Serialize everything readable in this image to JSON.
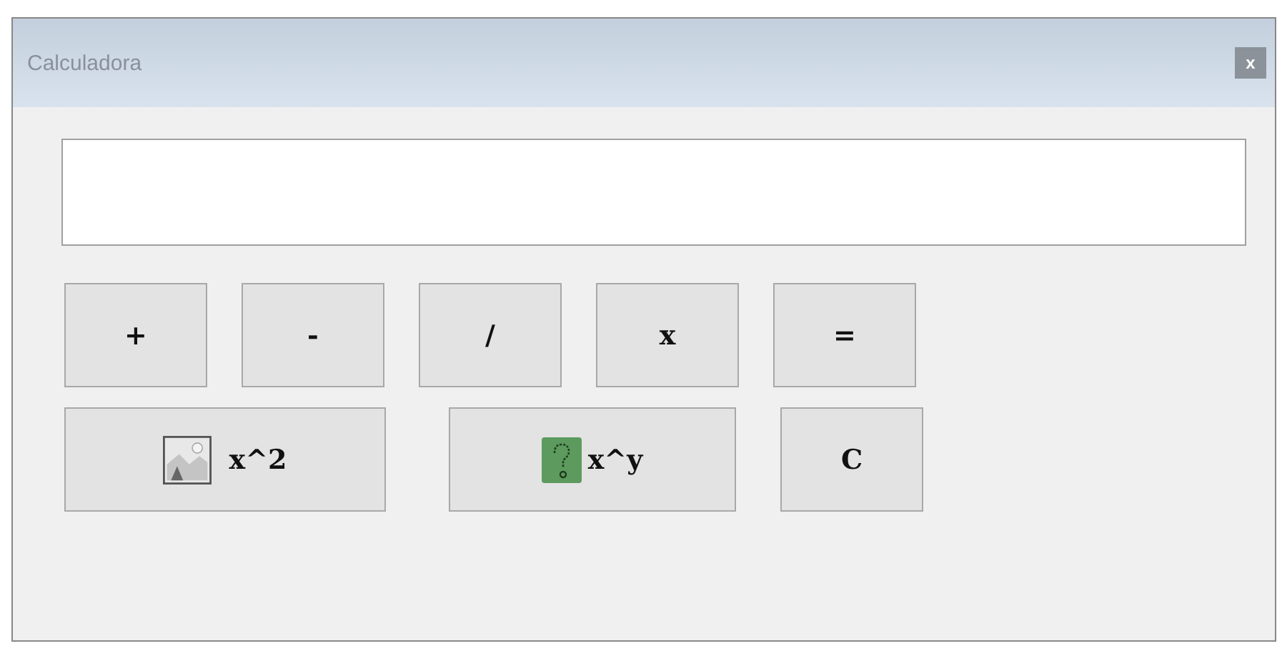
{
  "window": {
    "title": "Calculadora",
    "close": "x"
  },
  "rows": [
    [
      {
        "label": "+",
        "kind": "plain"
      },
      {
        "label": "-",
        "kind": "plain"
      },
      {
        "label": "/",
        "kind": "plain"
      },
      {
        "label": "x",
        "kind": "plain"
      },
      {
        "label": "=",
        "kind": "plain"
      }
    ],
    [
      {
        "label": "x^2",
        "kind": "image"
      },
      {
        "label": "x^y",
        "kind": "question"
      },
      {
        "label": "C",
        "kind": "plain"
      }
    ]
  ]
}
